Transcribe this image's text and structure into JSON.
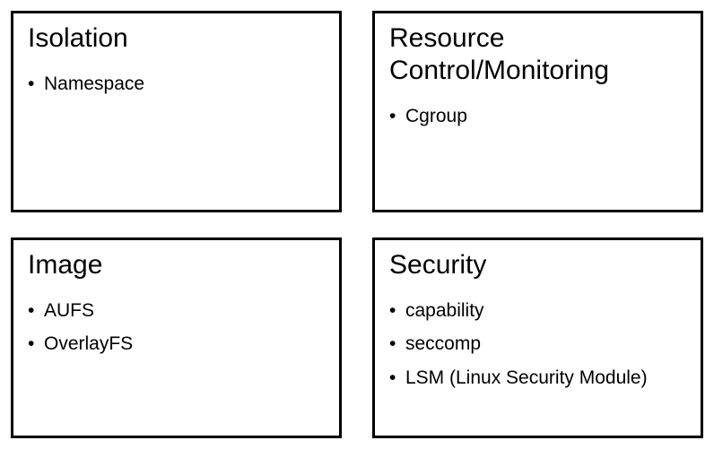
{
  "cards": [
    {
      "title": "Isolation",
      "items": [
        "Namespace"
      ]
    },
    {
      "title": "Resource Control/Monitoring",
      "items": [
        "Cgroup"
      ]
    },
    {
      "title": "Image",
      "items": [
        "AUFS",
        "OverlayFS"
      ]
    },
    {
      "title": "Security",
      "items": [
        "capability",
        "seccomp",
        "LSM (Linux Security Module)"
      ]
    }
  ]
}
